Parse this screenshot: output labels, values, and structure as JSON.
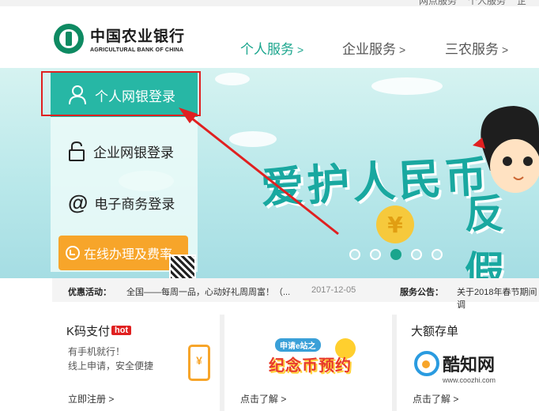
{
  "topbar": {
    "left_text": "网点服务",
    "right_text": "个人服务",
    "far_text": "企"
  },
  "header": {
    "logo_cn": "中国农业银行",
    "logo_en": "AGRICULTURAL BANK OF CHINA",
    "nav": [
      {
        "label": "个人服务",
        "chevron": ">",
        "active": true
      },
      {
        "label": "企业服务",
        "chevron": ">",
        "active": false
      },
      {
        "label": "三农服务",
        "chevron": ">",
        "active": false
      }
    ]
  },
  "login_panel": {
    "personal_login": "个人网银登录",
    "corporate_login": "企业网银登录",
    "ecommerce_login": "电子商务登录",
    "online_service": "在线办理及费率"
  },
  "banner": {
    "slogan_line1": "爱护人民币",
    "slogan_line2": "反假",
    "currency_symbol": "¥",
    "slide_count": 5,
    "active_slide": 3
  },
  "activity_bar": {
    "label": "优惠活动：",
    "text": "全国——每周一品，心动好礼周周富！（...",
    "date": "2017-12-05",
    "notice_label": "服务公告：",
    "notice_text": "关于2018年春节期间调"
  },
  "cards": [
    {
      "title": "K码支付",
      "badge": "hot",
      "desc1": "有手机就行！",
      "desc2": "线上申请，安全便捷",
      "link": "立即注册 >",
      "icon": "¥"
    },
    {
      "promo_top": "申请e站之",
      "promo_main": "纪念币预约",
      "link": "点击了解 >"
    },
    {
      "title": "大额存单",
      "link": "点击了解 >"
    }
  ],
  "watermark": {
    "text": "酷知网",
    "url": "www.coozhi.com"
  },
  "colors": {
    "brand": "#1aa58d",
    "highlight": "#e02020",
    "orange": "#f7a52a"
  }
}
